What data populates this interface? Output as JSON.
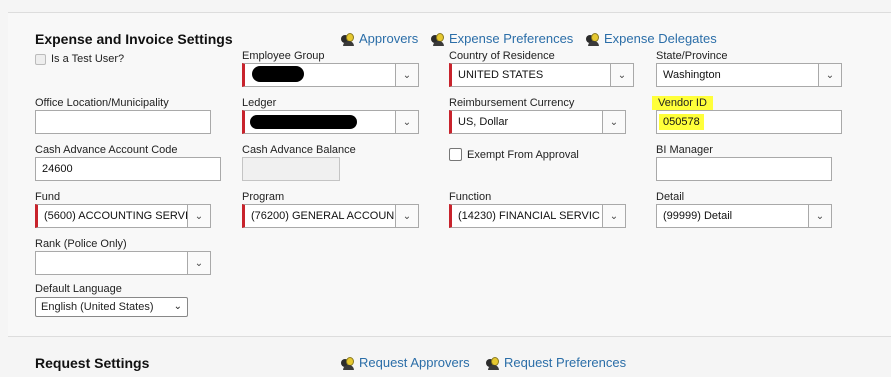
{
  "sections": {
    "expense": {
      "title": "Expense and Invoice Settings",
      "links": [
        "Approvers",
        "Expense Preferences",
        "Expense Delegates"
      ]
    },
    "request": {
      "title": "Request Settings",
      "links": [
        "Request Approvers",
        "Request Preferences"
      ]
    }
  },
  "fields": {
    "is_test_user": {
      "label": "Is a Test User?",
      "checked": false
    },
    "employee_group": {
      "label": "Employee Group",
      "value": ""
    },
    "country": {
      "label": "Country of Residence",
      "value": "UNITED STATES"
    },
    "state": {
      "label": "State/Province",
      "value": "Washington"
    },
    "office": {
      "label": "Office Location/Municipality",
      "value": ""
    },
    "ledger": {
      "label": "Ledger",
      "value": ""
    },
    "currency": {
      "label": "Reimbursement Currency",
      "value": "US, Dollar"
    },
    "vendor_id": {
      "label": "Vendor ID",
      "value": "050578"
    },
    "cash_adv_code": {
      "label": "Cash Advance Account Code",
      "value": "24600"
    },
    "cash_adv_balance": {
      "label": "Cash Advance Balance",
      "value": ""
    },
    "exempt": {
      "label": "Exempt From Approval",
      "checked": false
    },
    "bi_manager": {
      "label": "BI Manager",
      "value": ""
    },
    "fund": {
      "label": "Fund",
      "value": "(5600) ACCOUNTING SERVI"
    },
    "program": {
      "label": "Program",
      "value": "(76200) GENERAL ACCOUN"
    },
    "function": {
      "label": "Function",
      "value": "(14230) FINANCIAL SERVIC"
    },
    "detail": {
      "label": "Detail",
      "value": "(99999) Detail"
    },
    "rank": {
      "label": "Rank (Police Only)",
      "value": ""
    },
    "language": {
      "label": "Default Language",
      "value": "English (United States)"
    }
  },
  "colors": {
    "link": "#2b6ea8",
    "required": "#c8232c",
    "highlight": "#ffff3a"
  },
  "icons": {
    "link_icon": "user-group-icon",
    "dropdown": "chevron-down-icon"
  }
}
